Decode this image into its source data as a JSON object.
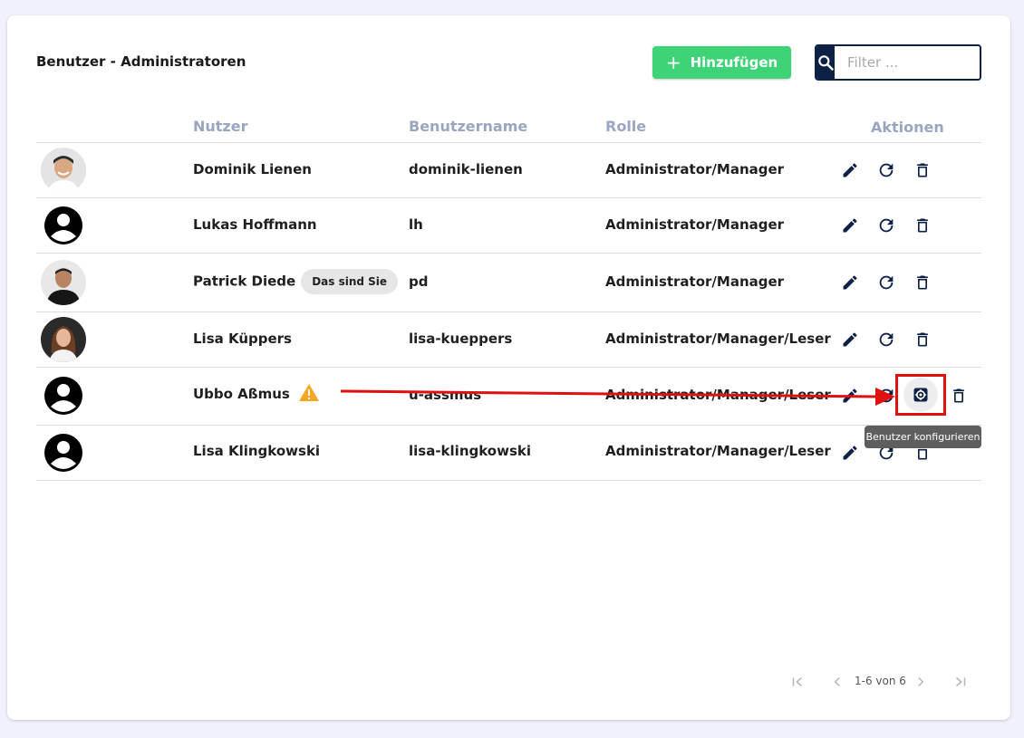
{
  "page": {
    "title": "Benutzer - Administratoren"
  },
  "toolbar": {
    "add_label": "Hinzufügen",
    "add_icon": "+",
    "filter_placeholder": "Filter ..."
  },
  "table": {
    "headers": {
      "user": "Nutzer",
      "username": "Benutzername",
      "role": "Rolle",
      "actions": "Aktionen"
    },
    "rows": [
      {
        "name": "Dominik Lienen",
        "username": "dominik-lienen",
        "role": "Administrator/Manager",
        "avatar": "photo"
      },
      {
        "name": "Lukas Hoffmann",
        "username": "lh",
        "role": "Administrator/Manager",
        "avatar": "placeholder"
      },
      {
        "name": "Patrick Diede",
        "badge": "Das sind Sie",
        "username": "pd",
        "role": "Administrator/Manager",
        "avatar": "photo"
      },
      {
        "name": "Lisa Küppers",
        "username": "lisa-kueppers",
        "role": "Administrator/Manager/Leser",
        "avatar": "photo"
      },
      {
        "name": "Ubbo Aßmus",
        "warning": true,
        "username": "u-assmus",
        "role": "Administrator/Manager/Leser",
        "avatar": "placeholder"
      },
      {
        "name": "Lisa Klingkowski",
        "username": "lisa-klingkowski",
        "role": "Administrator/Manager/Leser",
        "avatar": "placeholder"
      }
    ]
  },
  "tooltip": {
    "text": "Benutzer konfigurieren"
  },
  "pagination": {
    "range_text": "1-6 von 6"
  },
  "colors": {
    "navy": "#0d2147",
    "green": "#3fd378",
    "header": "#9aa6c0",
    "warning": "#f5a623",
    "highlight": "#e01010"
  }
}
